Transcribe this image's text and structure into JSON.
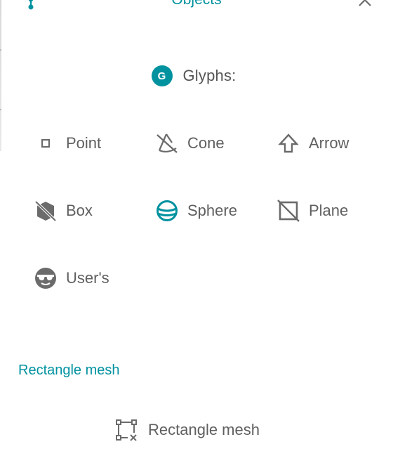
{
  "header": {
    "title": "Objects",
    "icons": {
      "left": "tree-icon",
      "right": "close-icon"
    }
  },
  "glyphs": {
    "heading": "Glyphs:",
    "badge_letter": "G",
    "items": [
      {
        "label": "Point",
        "icon": "point-icon"
      },
      {
        "label": "Cone",
        "icon": "cone-icon"
      },
      {
        "label": "Arrow",
        "icon": "arrow-up-icon"
      },
      {
        "label": "Box",
        "icon": "box-off-icon"
      },
      {
        "label": "Sphere",
        "icon": "sphere-icon"
      },
      {
        "label": "Plane",
        "icon": "plane-icon"
      },
      {
        "label": "User's",
        "icon": "user-glyph-icon"
      }
    ]
  },
  "rectangle_mesh": {
    "section_label": "Rectangle mesh",
    "item_label": "Rectangle mesh",
    "icon": "rectangle-mesh-icon"
  },
  "colors": {
    "accent": "#00929f",
    "icon_gray": "#6b6b6b",
    "text_gray": "#5f5f5f"
  }
}
